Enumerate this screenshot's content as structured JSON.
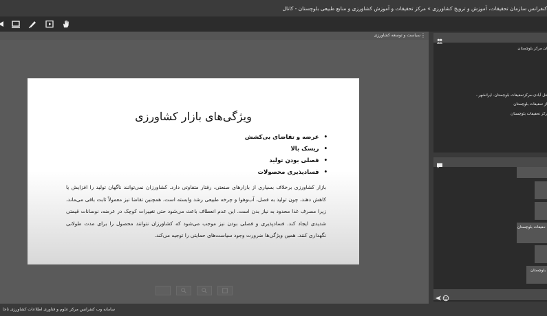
{
  "window": {
    "title": "کنفرانس سازمان تحقیقات، آموزش و ترویج کشاورزی » مرکز تحقیقات و آموزش کشاورزی و منابع طبیعی بلوچستان - کانال"
  },
  "toolbar": {
    "icons": [
      "arrow-icon",
      "screen-share-icon",
      "pen-icon",
      "video-icon",
      "hand-icon"
    ]
  },
  "share_pod": {
    "title": "سیاست و توسعه کشاورزی",
    "menu_label": "⋮"
  },
  "slide": {
    "title": "ویژگی‌های بازار کشاورزی",
    "bullets": [
      "عرضه و تقاضای بی‌کشش",
      "ریسک بالا",
      "فصلی بودن تولید",
      "فسادپذیری محصولات"
    ],
    "paragraph": "بازار کشاورزی برخلاف بسیاری از بازارهای صنعتی، رفتار متفاوتی دارد. کشاورزان نمی‌توانند ناگهان تولید را افزایش یا کاهش دهند، چون تولید به فصل، آب‌وهوا و چرخه طبیعی رشد وابسته است. همچنین تقاضا نیز معمولاً ثابت باقی می‌ماند، زیرا مصرف غذا محدود به نیاز بدن است. این عدم انعطاف باعث می‌شود حتی تغییرات کوچک در عرضه، نوسانات قیمتی شدیدی ایجاد کند. فسادپذیری و فصلی بودن نیز موجب می‌شود که کشاورزان نتوانند محصول را برای مدت طولانی نگهداری کنند. همین ویژگی‌ها ضرورت وجود سیاست‌های حمایتی را توجیه می‌کند."
  },
  "status_bar": {
    "text": "سامانه وب کنفرانس مرکز علوم و فناوری اطلاعات کشاورزی ناجا"
  },
  "attendees": {
    "items": [
      "ان مرکز بلوچستان",
      "فل آبادی-مرکزتحقیقات بلوچستان- ایرانشهر..",
      "از تحقیقات بلوچستان",
      "رکز تحقیقات بلوچستان"
    ]
  },
  "chat": {
    "messages": [
      "حقیقات بلوچستان",
      "بلوچستان"
    ]
  }
}
